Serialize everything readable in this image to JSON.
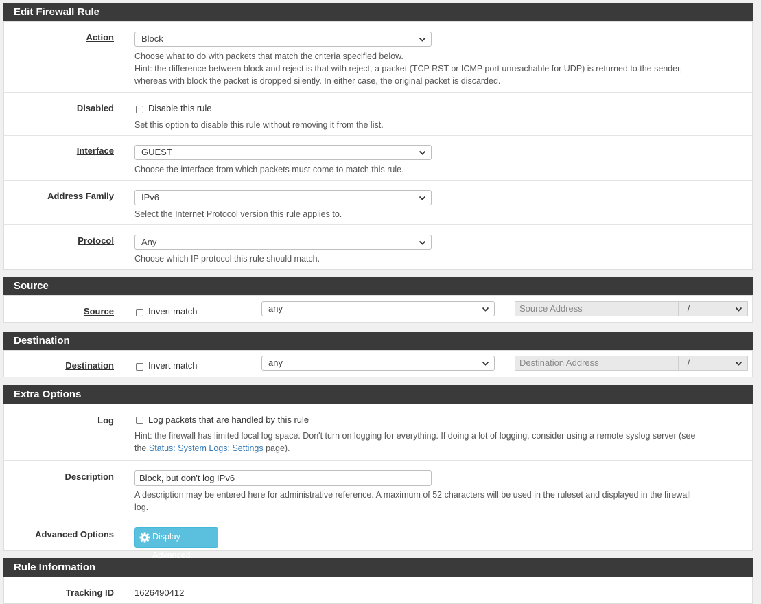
{
  "sections": {
    "edit": "Edit Firewall Rule",
    "source": "Source",
    "destination": "Destination",
    "extra": "Extra Options",
    "rule_info": "Rule Information"
  },
  "action": {
    "label": "Action",
    "value": "Block",
    "help1": "Choose what to do with packets that match the criteria specified below.",
    "help2": "Hint: the difference between block and reject is that with reject, a packet (TCP RST or ICMP port unreachable for UDP) is returned to the sender,",
    "help3": "whereas with block the packet is dropped silently. In either case, the original packet is discarded."
  },
  "disabled": {
    "label": "Disabled",
    "checkbox_label": "Disable this rule",
    "help": "Set this option to disable this rule without removing it from the list."
  },
  "interface": {
    "label": "Interface",
    "value": "GUEST",
    "help": "Choose the interface from which packets must come to match this rule."
  },
  "address_family": {
    "label": "Address Family",
    "value": "IPv6",
    "help": "Select the Internet Protocol version this rule applies to."
  },
  "protocol": {
    "label": "Protocol",
    "value": "Any",
    "help": "Choose which IP protocol this rule should match."
  },
  "source": {
    "label": "Source",
    "invert_label": "Invert match",
    "type_value": "any",
    "address_placeholder": "Source Address",
    "slash": "/"
  },
  "destination": {
    "label": "Destination",
    "invert_label": "Invert match",
    "type_value": "any",
    "address_placeholder": "Destination Address",
    "slash": "/"
  },
  "log": {
    "label": "Log",
    "checkbox_label": "Log packets that are handled by this rule",
    "help1": "Hint: the firewall has limited local log space. Don't turn on logging for everything. If doing a lot of logging, consider using a remote syslog server (see",
    "help2_pre": "the ",
    "help2_link": "Status: System Logs: Settings",
    "help2_post": " page)."
  },
  "description": {
    "label": "Description",
    "value": "Block, but don't log IPv6",
    "help1": "A description may be entered here for administrative reference. A maximum of 52 characters will be used in the ruleset and displayed in the firewall",
    "help2": "log."
  },
  "advanced": {
    "label": "Advanced Options",
    "button": "Display Advanced"
  },
  "rule_info": {
    "tracking_label": "Tracking ID",
    "tracking_value": "1626490412"
  },
  "colors": {
    "header_bg": "#3a3a3a",
    "button_info": "#5bc0de",
    "link": "#337ab7"
  }
}
